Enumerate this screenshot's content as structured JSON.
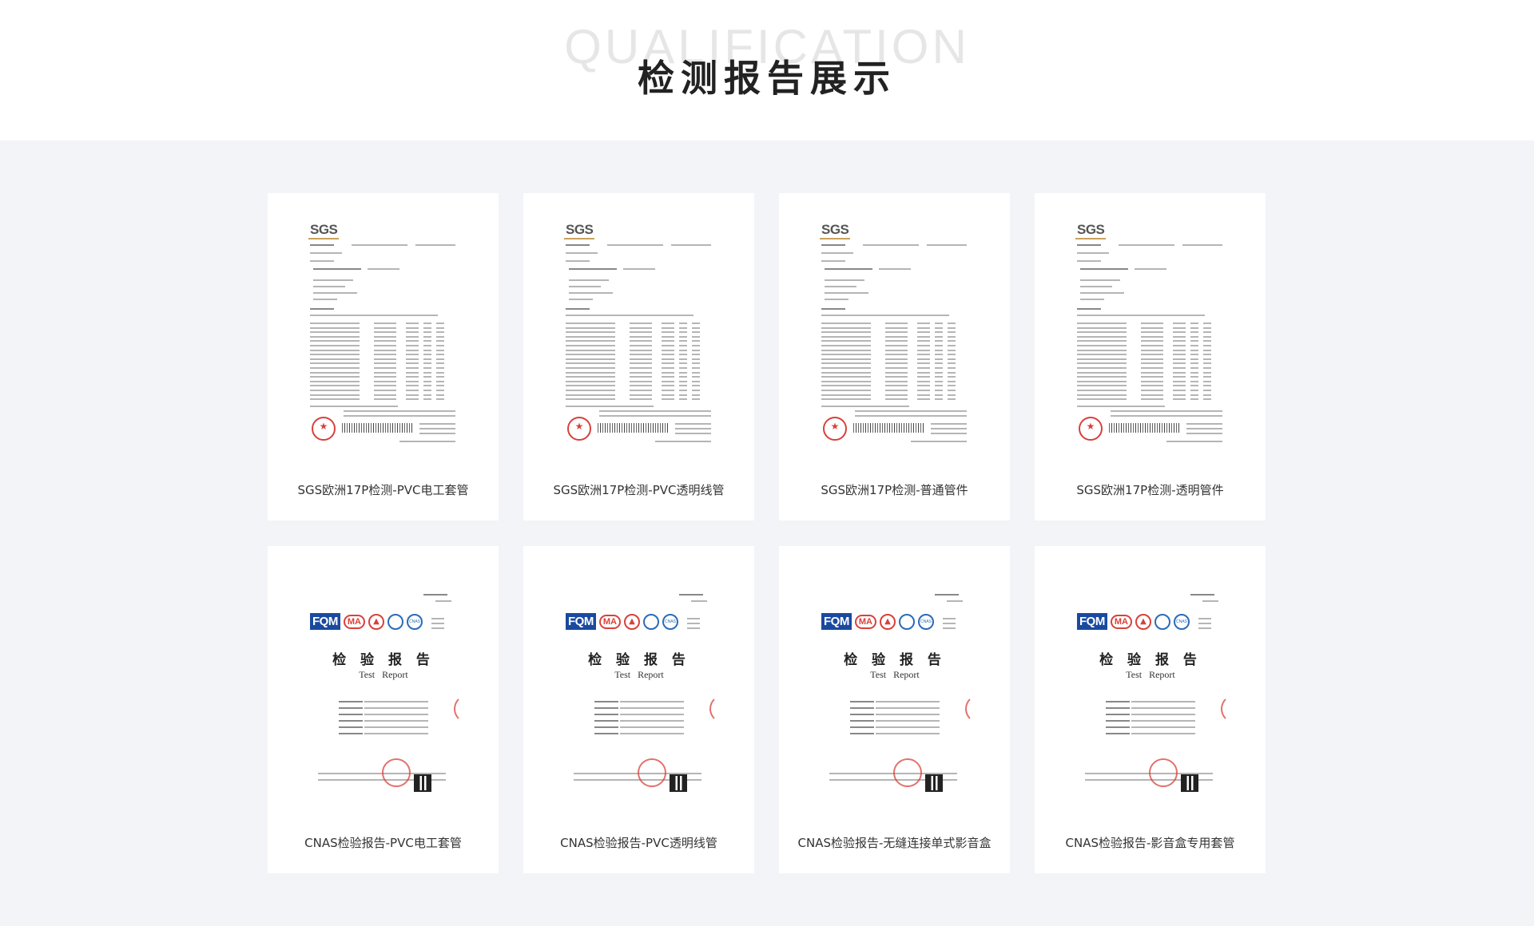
{
  "header": {
    "en_title": "QUALIFICATION",
    "cn_title": "检测报告展示"
  },
  "reports": [
    {
      "type": "sgs",
      "caption": "SGS欧洲17P检测-PVC电工套管",
      "logo": "SGS"
    },
    {
      "type": "sgs",
      "caption": "SGS欧洲17P检测-PVC透明线管",
      "logo": "SGS"
    },
    {
      "type": "sgs",
      "caption": "SGS欧洲17P检测-普通管件",
      "logo": "SGS"
    },
    {
      "type": "sgs",
      "caption": "SGS欧洲17P检测-透明管件",
      "logo": "SGS"
    },
    {
      "type": "cnas",
      "caption": "CNAS检验报告-PVC电工套管",
      "doc_title": "检 验 报 告",
      "doc_subtitle": "Test Report"
    },
    {
      "type": "cnas",
      "caption": "CNAS检验报告-PVC透明线管",
      "doc_title": "检 验 报 告",
      "doc_subtitle": "Test Report"
    },
    {
      "type": "cnas",
      "caption": "CNAS检验报告-无缝连接单式影音盒",
      "doc_title": "检 验 报 告",
      "doc_subtitle": "Test Report"
    },
    {
      "type": "cnas",
      "caption": "CNAS检验报告-影音盒专用套管",
      "doc_title": "检 验 报 告",
      "doc_subtitle": "Test Report"
    }
  ],
  "cnas_logos": {
    "fqm": "FQM",
    "ma": "MA",
    "ilac": "ilac-MRA",
    "cnas": "CNAS"
  },
  "colors": {
    "background": "#f3f4f8",
    "card": "#ffffff",
    "stamp_red": "#d8413b",
    "fqm_blue": "#1a4aa0"
  }
}
